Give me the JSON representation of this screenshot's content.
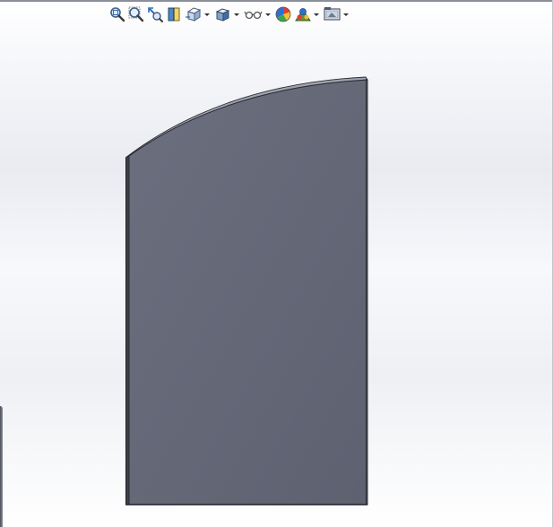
{
  "viewport": {
    "background_top": "#ffffff",
    "background_mid": "#e9ebf1",
    "part_face_color": "#646877",
    "part_edge_color": "#2b2d33"
  },
  "toolbar": {
    "buttons": [
      {
        "icon": "zoom-to-fit-icon",
        "dropdown": false
      },
      {
        "icon": "zoom-to-area-icon",
        "dropdown": false
      },
      {
        "icon": "previous-view-icon",
        "dropdown": false
      },
      {
        "icon": "section-view-icon",
        "dropdown": false
      },
      {
        "icon": "view-orientation-icon",
        "dropdown": true
      },
      {
        "icon": "display-style-icon",
        "dropdown": true
      },
      {
        "icon": "hide-show-items-icon",
        "dropdown": true
      },
      {
        "icon": "edit-appearance-icon",
        "dropdown": false
      },
      {
        "icon": "apply-scene-icon",
        "dropdown": true
      },
      {
        "icon": "view-settings-icon",
        "dropdown": true
      }
    ]
  }
}
